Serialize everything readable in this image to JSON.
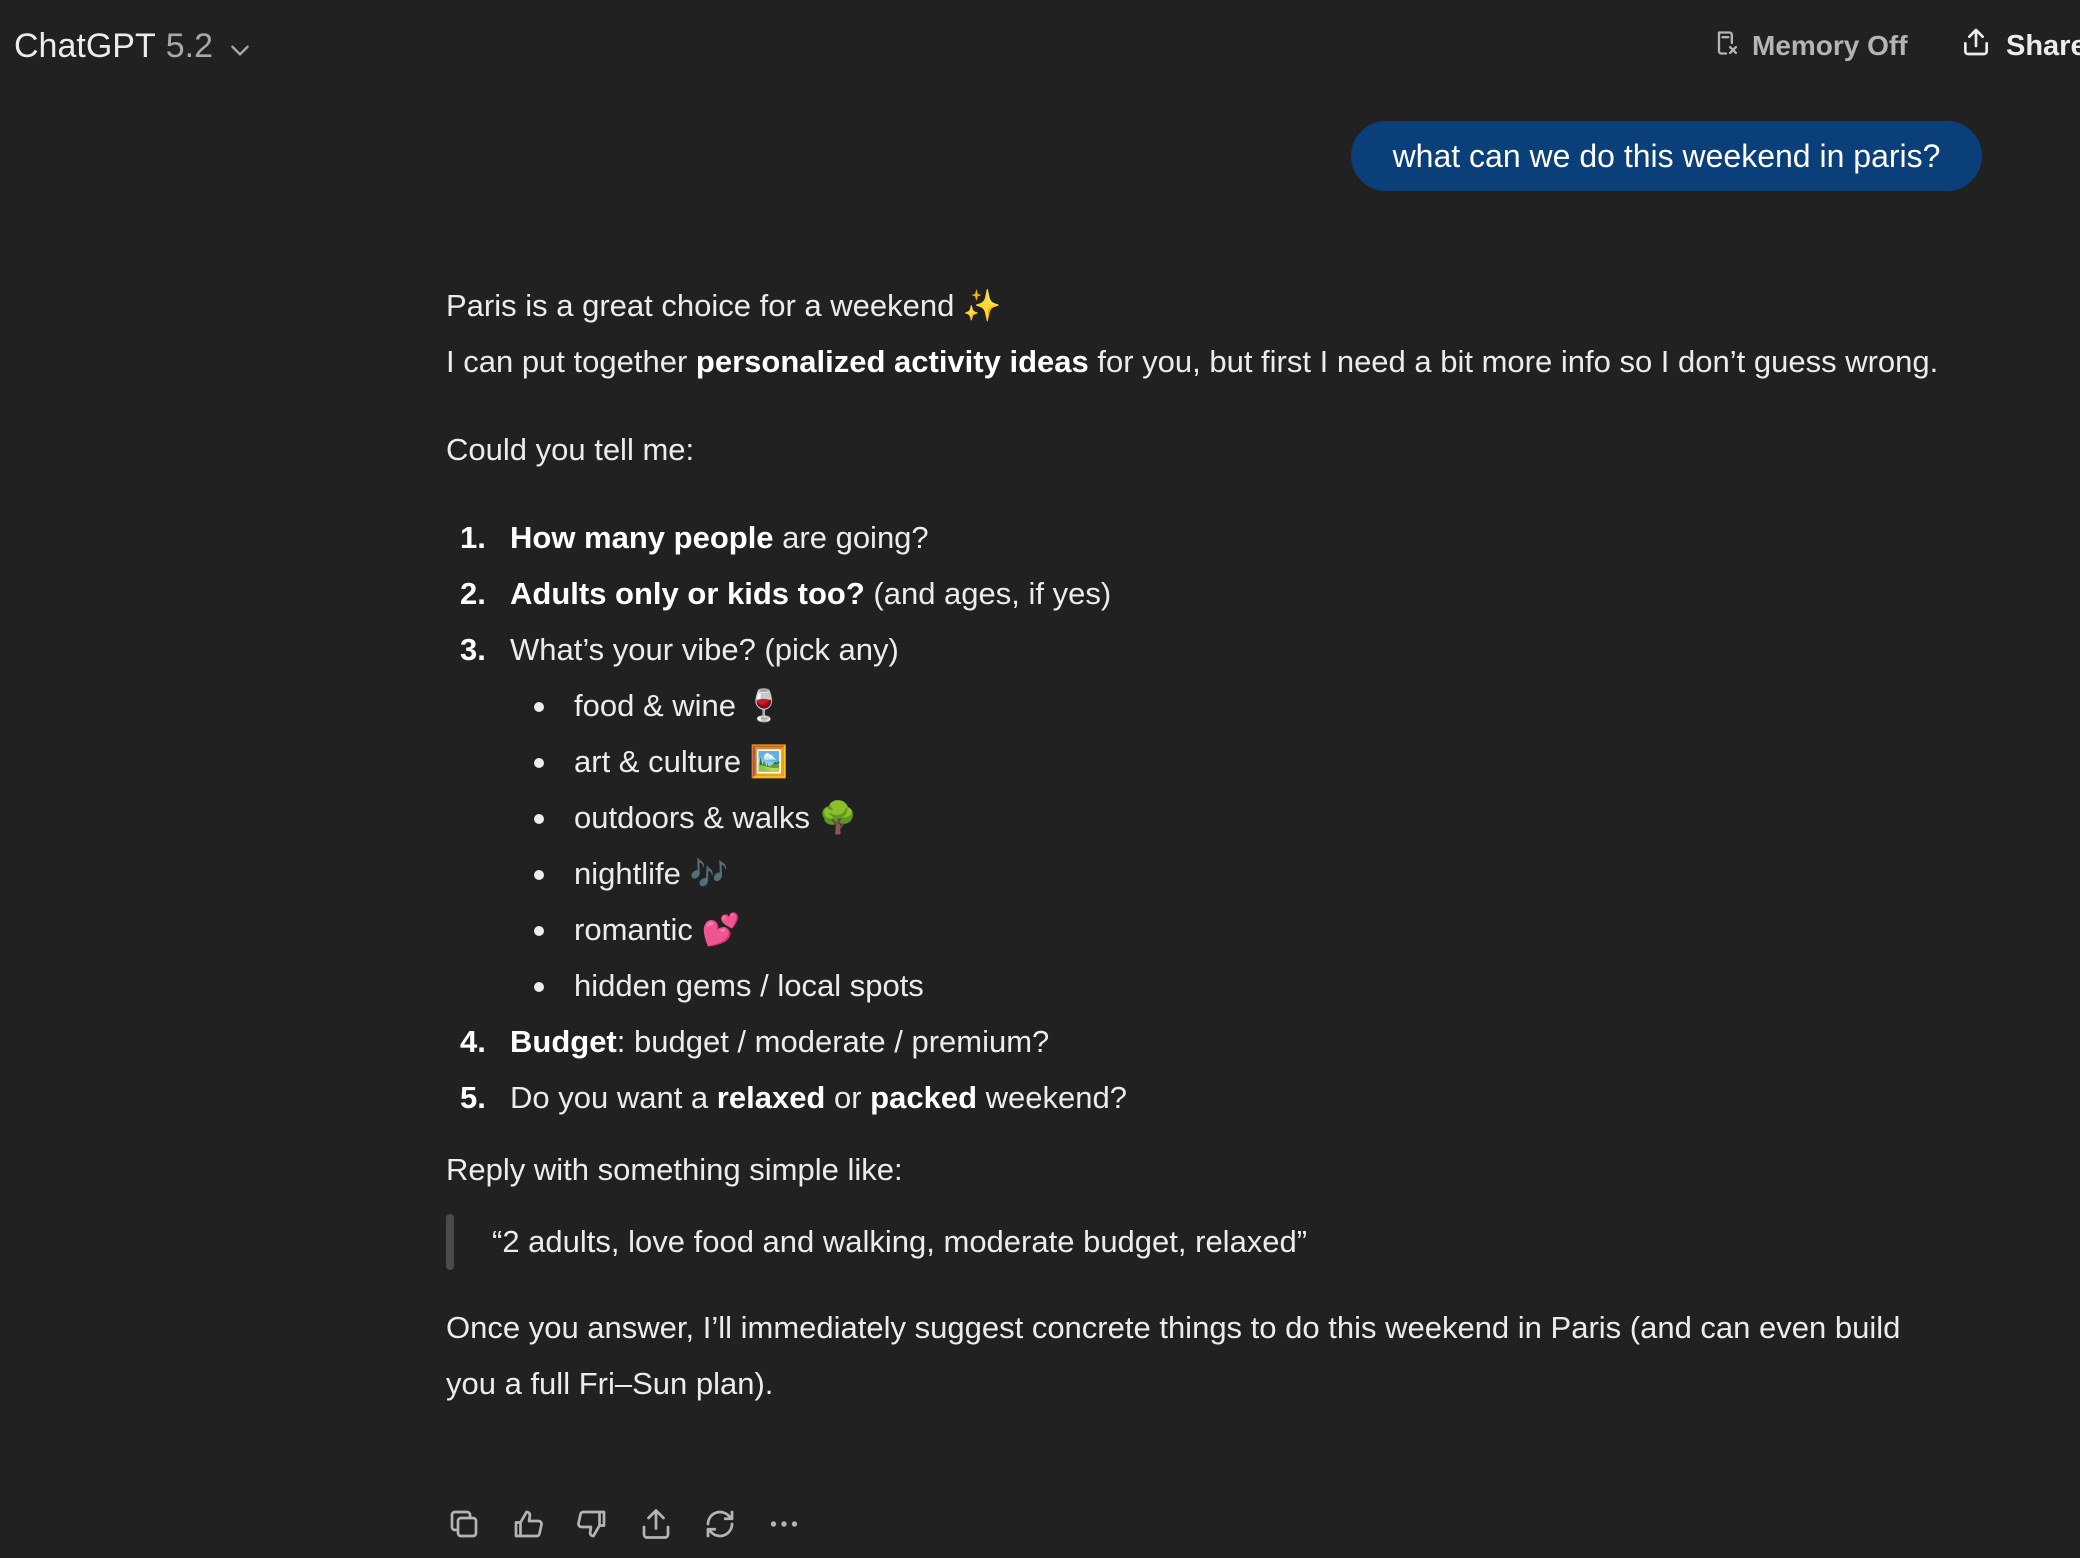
{
  "header": {
    "model_name": "ChatGPT",
    "model_version": "5.2",
    "memory_label": "Memory Off",
    "share_label": "Share"
  },
  "conversation": {
    "user_message": "what can we do this weekend in paris?",
    "assistant": {
      "intro_line1": "Paris is a great choice for a weekend ✨",
      "intro_line2_pre": "I can put together ",
      "intro_line2_bold": "personalized activity ideas",
      "intro_line2_post": " for you, but first I need a bit more info so I don’t guess wrong.",
      "ask": "Could you tell me:",
      "q1_num": "1.",
      "q1_bold": "How many people",
      "q1_rest": " are going?",
      "q2_num": "2.",
      "q2_bold": "Adults only or kids too?",
      "q2_rest": " (and ages, if yes)",
      "q3_num": "3.",
      "q3_text": "What’s your vibe? (pick any)",
      "vibes": [
        "food & wine 🍷",
        "art & culture 🖼️",
        "outdoors & walks 🌳",
        "nightlife 🎶",
        "romantic 💕",
        "hidden gems / local spots"
      ],
      "q4_num": "4.",
      "q4_bold": "Budget",
      "q4_rest": ": budget / moderate / premium?",
      "q5_num": "5.",
      "q5_pre": "Do you want a ",
      "q5_bold1": "relaxed",
      "q5_mid": " or ",
      "q5_bold2": "packed",
      "q5_post": " weekend?",
      "reply_intro": "Reply with something simple like:",
      "example_quote": "“2 adults, love food and walking, moderate budget, relaxed”",
      "closing": "Once you answer, I’ll immediately suggest concrete things to do this weekend in Paris (and can even build you a full Fri–Sun plan)."
    }
  },
  "actions": [
    {
      "icon": "copy-icon"
    },
    {
      "icon": "thumbs-up-icon"
    },
    {
      "icon": "thumbs-down-icon"
    },
    {
      "icon": "share-icon"
    },
    {
      "icon": "regenerate-icon"
    },
    {
      "icon": "more-icon"
    }
  ],
  "colors": {
    "background": "#212121",
    "text": "#ececec",
    "user_bubble": "#0b3f7a",
    "muted": "#a8a8a8"
  }
}
